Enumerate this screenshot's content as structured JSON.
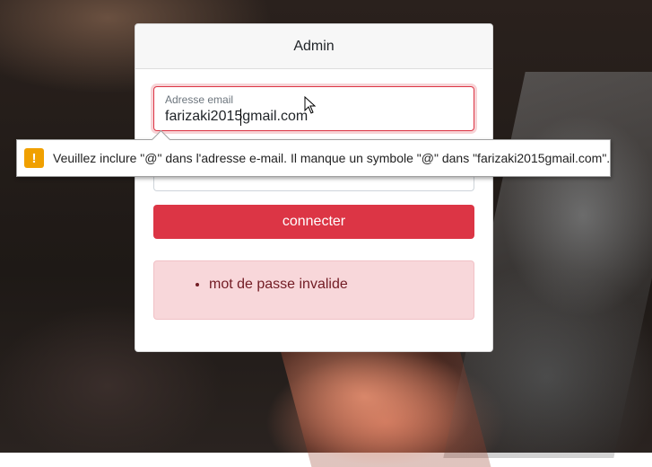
{
  "card": {
    "title": "Admin"
  },
  "email": {
    "label": "Adresse email",
    "value": "farizaki2015gmail.com"
  },
  "submit": {
    "label": "connecter"
  },
  "alert": {
    "errors": [
      "mot de passe invalide"
    ]
  },
  "validation_tooltip": {
    "icon": "warning-icon",
    "message": "Veuillez inclure \"@\" dans l'adresse e-mail. Il manque un symbole \"@\" dans \"farizaki2015gmail.com\"."
  },
  "colors": {
    "danger": "#dc3545",
    "alert_bg": "#f8d7da",
    "alert_text": "#721c24",
    "warning": "#f0a000"
  }
}
